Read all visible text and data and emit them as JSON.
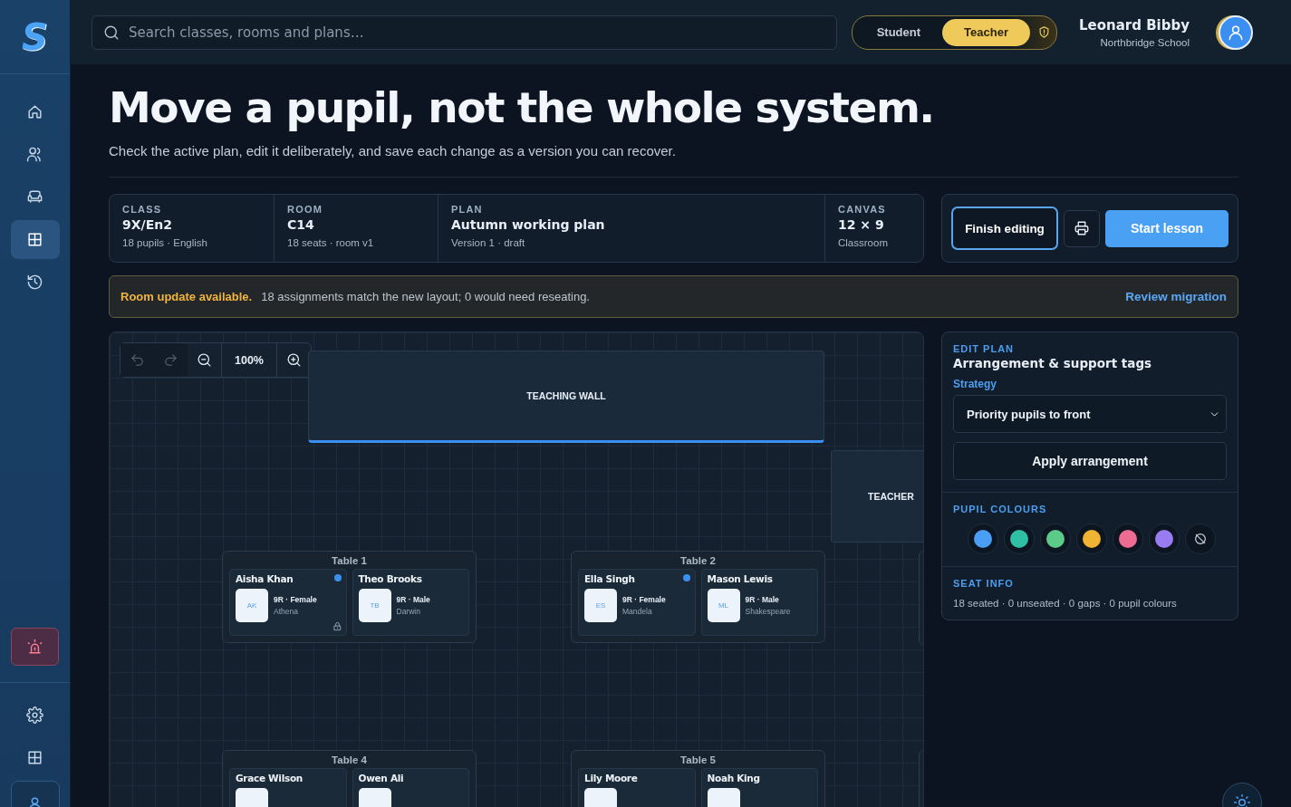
{
  "logo": {
    "letter": "S"
  },
  "sidebar": {
    "items": [
      {
        "kind": "home",
        "selected": false
      },
      {
        "kind": "people",
        "selected": false
      },
      {
        "kind": "seat",
        "selected": false
      },
      {
        "kind": "grid",
        "selected": true
      },
      {
        "kind": "history",
        "selected": false
      }
    ],
    "bottom": [
      {
        "kind": "gear",
        "selected": false
      },
      {
        "kind": "grid",
        "selected": false
      },
      {
        "kind": "user",
        "selected": true
      }
    ]
  },
  "search": {
    "placeholder": "Search classes, rooms and plans…"
  },
  "role_toggle": [
    {
      "label": "Student",
      "selected": false
    },
    {
      "label": "Teacher",
      "selected": true
    }
  ],
  "user": {
    "name": "Leonard Bibby",
    "school": "Northbridge School"
  },
  "hero": {
    "title": "Move a pupil, not the whole system.",
    "subtitle": "Check the active plan, edit it deliberately, and save each change as a version you can recover."
  },
  "summary": [
    {
      "label": "CLASS",
      "value": "9X/En2",
      "detail": "18 pupils · English"
    },
    {
      "label": "ROOM",
      "value": "C14",
      "detail": "18 seats · room v1"
    },
    {
      "label": "PLAN",
      "value": "Autumn working plan",
      "detail": "Version 1 · draft"
    },
    {
      "label": "CANVAS",
      "value": "12 × 9",
      "detail": "Classroom"
    }
  ],
  "actions": {
    "finish": "Finish editing",
    "start": "Start lesson"
  },
  "banner": {
    "title": "Room update available.",
    "message": "18 assignments match the new layout; 0 would need reseating.",
    "link": "Review migration"
  },
  "toolbar": {
    "buttons": [
      {
        "kind": "undo",
        "disabled": true
      },
      {
        "kind": "redo",
        "disabled": true
      },
      {
        "kind": "zoom-out",
        "disabled": false
      }
    ],
    "zoom": "100%"
  },
  "wall": {
    "label": "TEACHING WALL"
  },
  "desk": {
    "label": "TEACHER"
  },
  "tables": [
    {
      "name": "Table 1",
      "seats": [
        {
          "name": "Aisha Khan",
          "initials": "AK",
          "group": "9R · Female",
          "house": "Athena",
          "color": "#3b8ff0",
          "locked": true
        },
        {
          "name": "Theo Brooks",
          "initials": "TB",
          "group": "9R · Male",
          "house": "Darwin",
          "locked": false
        }
      ]
    },
    {
      "name": "Table 2",
      "seats": [
        {
          "name": "Ella Singh",
          "initials": "ES",
          "group": "9R · Female",
          "house": "Mandela",
          "color": "#3b8ff0",
          "locked": false
        },
        {
          "name": "Mason Lewis",
          "initials": "ML",
          "group": "9R · Male",
          "house": "Shakespeare",
          "locked": false
        }
      ]
    },
    {
      "name": "Table 4",
      "seats": [
        {
          "name": "Grace Wilson",
          "locked": false
        },
        {
          "name": "Owen Ali",
          "locked": false
        }
      ]
    },
    {
      "name": "Table 5",
      "seats": [
        {
          "name": "Lily Moore",
          "locked": false
        },
        {
          "name": "Noah King",
          "locked": false
        }
      ]
    }
  ],
  "panel": {
    "eyebrow": "EDIT PLAN",
    "title": "Arrangement & support tags",
    "strategy_label": "Strategy",
    "strategy": "Priority pupils to front",
    "apply": "Apply arrangement",
    "colours_label": "PUPIL COLOURS",
    "colours": [
      {
        "color": "#4a9ff5"
      },
      {
        "color": "#2fbfa5"
      },
      {
        "color": "#5ccb8a"
      },
      {
        "color": "#f0b433"
      },
      {
        "color": "#ee6b92"
      },
      {
        "color": "#9a7cf2"
      }
    ],
    "seat_info_label": "SEAT INFO",
    "seat_info": "18 seated · 0 unseated · 0 gaps · 0 pupil colours"
  }
}
